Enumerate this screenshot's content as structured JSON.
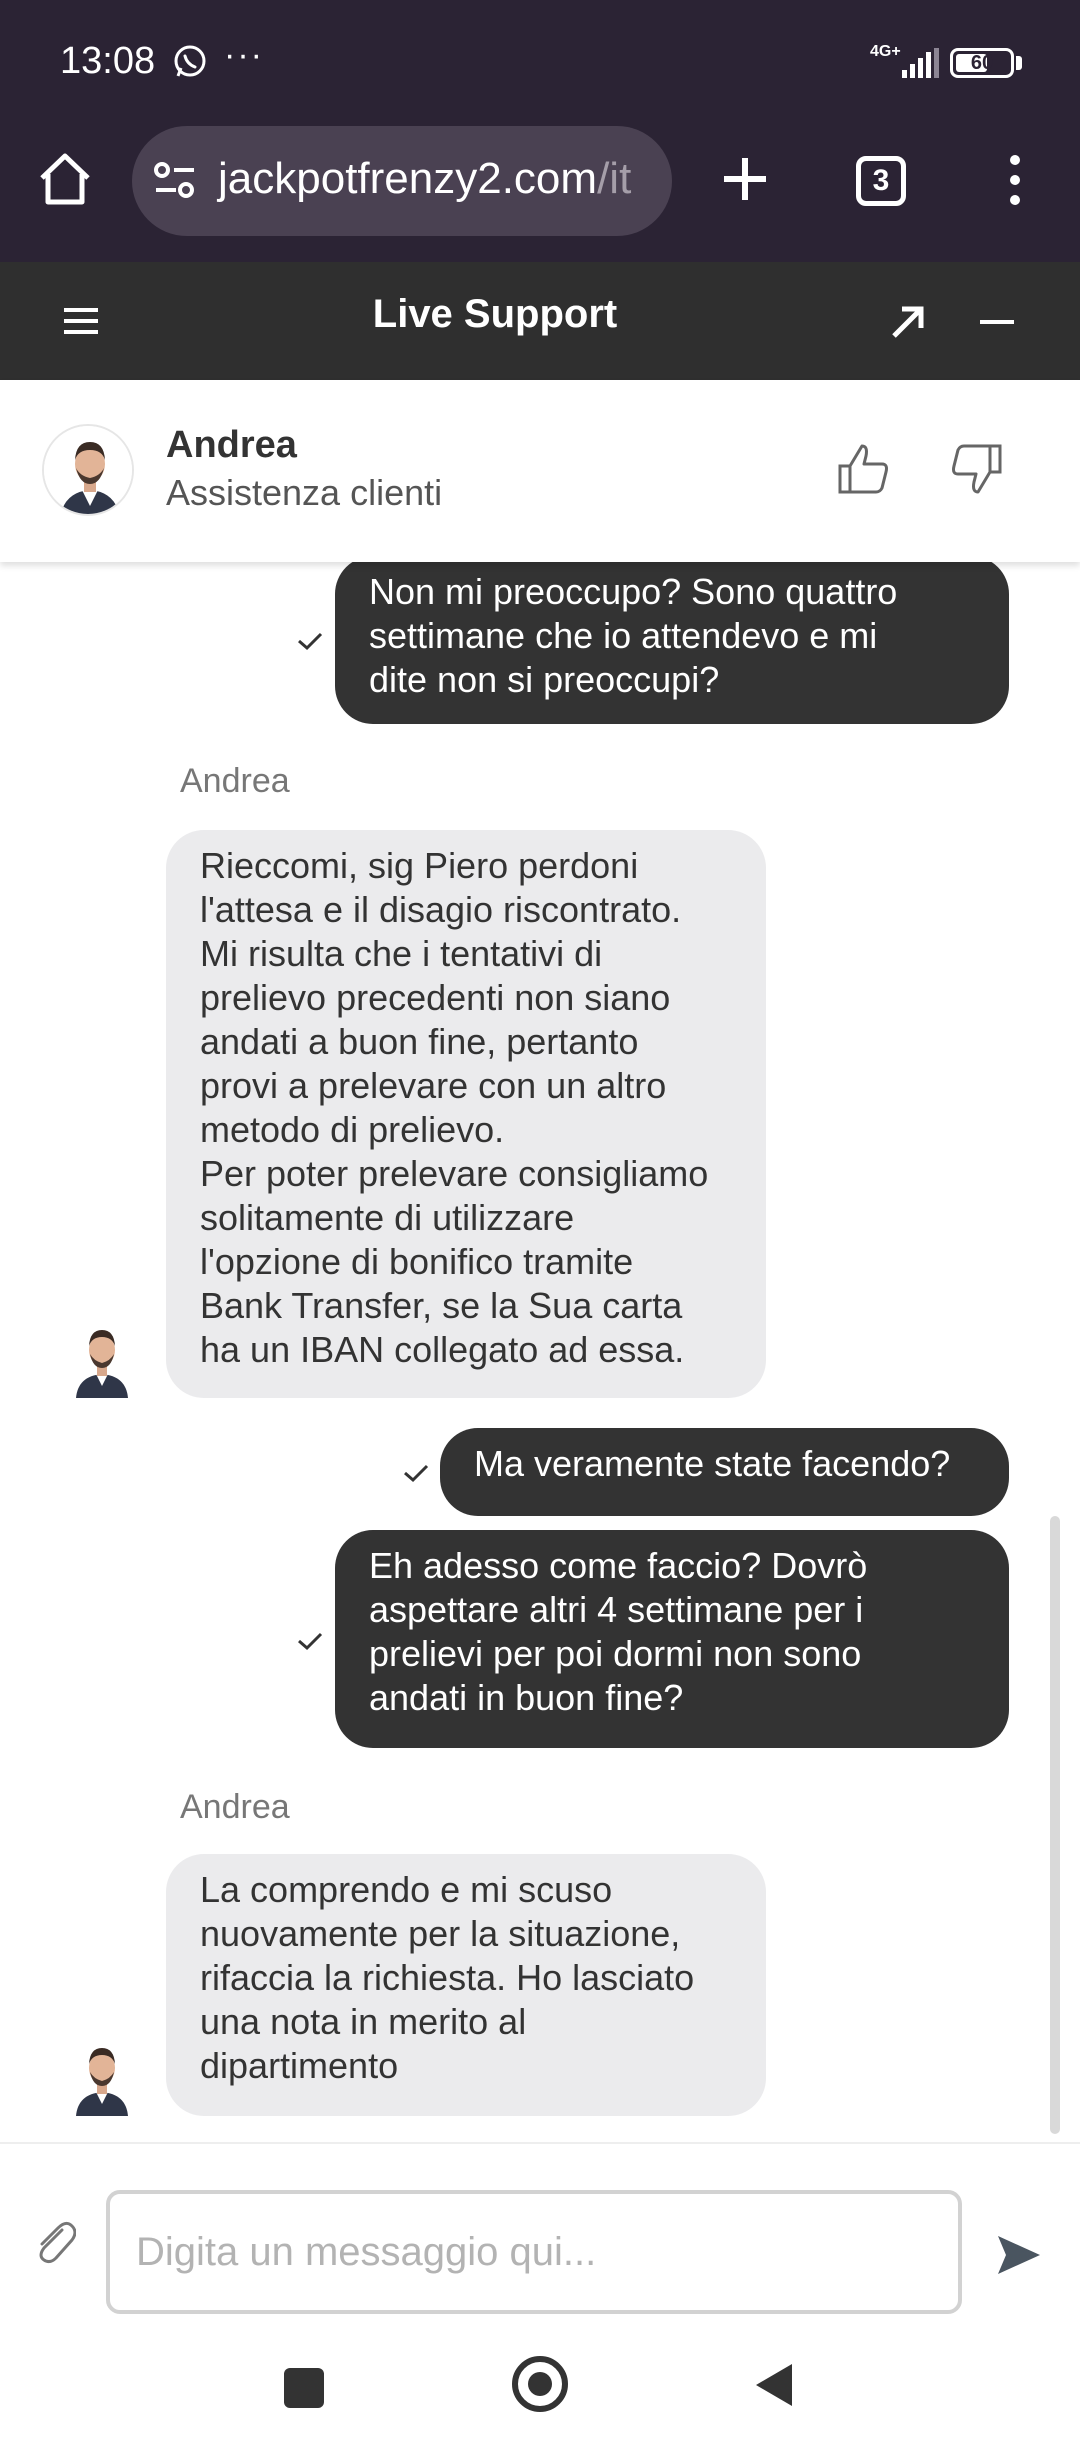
{
  "status_bar": {
    "time": "13:08",
    "network": "4G+",
    "battery": "60",
    "battery_level": 0.6
  },
  "browser": {
    "url_domain": "jackpotfrenzy2.com",
    "url_path": "/it",
    "tab_count": "3"
  },
  "support_header": {
    "title": "Live Support"
  },
  "agent": {
    "name": "Andrea",
    "role": "Assistenza clienti"
  },
  "messages": [
    {
      "direction": "out",
      "lines": [
        "Non mi preoccupo? Sono quattro",
        "settimane che io attendevo e mi",
        "dite non si preoccupi?"
      ]
    },
    {
      "direction": "in",
      "sender": "Andrea",
      "lines": [
        "Rieccomi, sig Piero perdoni",
        "l'attesa e il disagio riscontrato.",
        "Mi risulta che i tentativi di",
        "prelievo precedenti non siano",
        "andati a buon fine, pertanto",
        "provi a prelevare con un altro",
        "metodo di prelievo.",
        "Per poter prelevare consigliamo",
        "solitamente di utilizzare",
        "l'opzione di bonifico tramite",
        "Bank Transfer, se la Sua carta",
        "ha un IBAN collegato ad essa."
      ]
    },
    {
      "direction": "out",
      "lines": [
        "Ma veramente state facendo?"
      ]
    },
    {
      "direction": "out",
      "lines": [
        "Eh adesso come faccio? Dovrò",
        "aspettare altri 4 settimane per i",
        "prelievi per poi dormi non sono",
        "andati in buon fine?"
      ]
    },
    {
      "direction": "in",
      "sender": "Andrea",
      "lines": [
        "La comprendo e mi scuso",
        "nuovamente per la situazione,",
        "rifaccia la richiesta. Ho lasciato",
        "una nota in merito al",
        "dipartimento"
      ]
    }
  ],
  "composer": {
    "placeholder": "Digita un messaggio qui..."
  },
  "icons": {
    "status": [
      "whatsapp-icon",
      "more-icon",
      "signal-icon",
      "battery-icon"
    ],
    "browser": [
      "home-icon",
      "site-info-icon",
      "plus-icon",
      "tabs-icon",
      "menu-icon"
    ],
    "chat": [
      "hamburger-icon",
      "expand-icon",
      "minimize-icon",
      "thumbs-up-icon",
      "thumbs-down-icon",
      "check-icon",
      "attach-icon",
      "send-icon"
    ]
  }
}
